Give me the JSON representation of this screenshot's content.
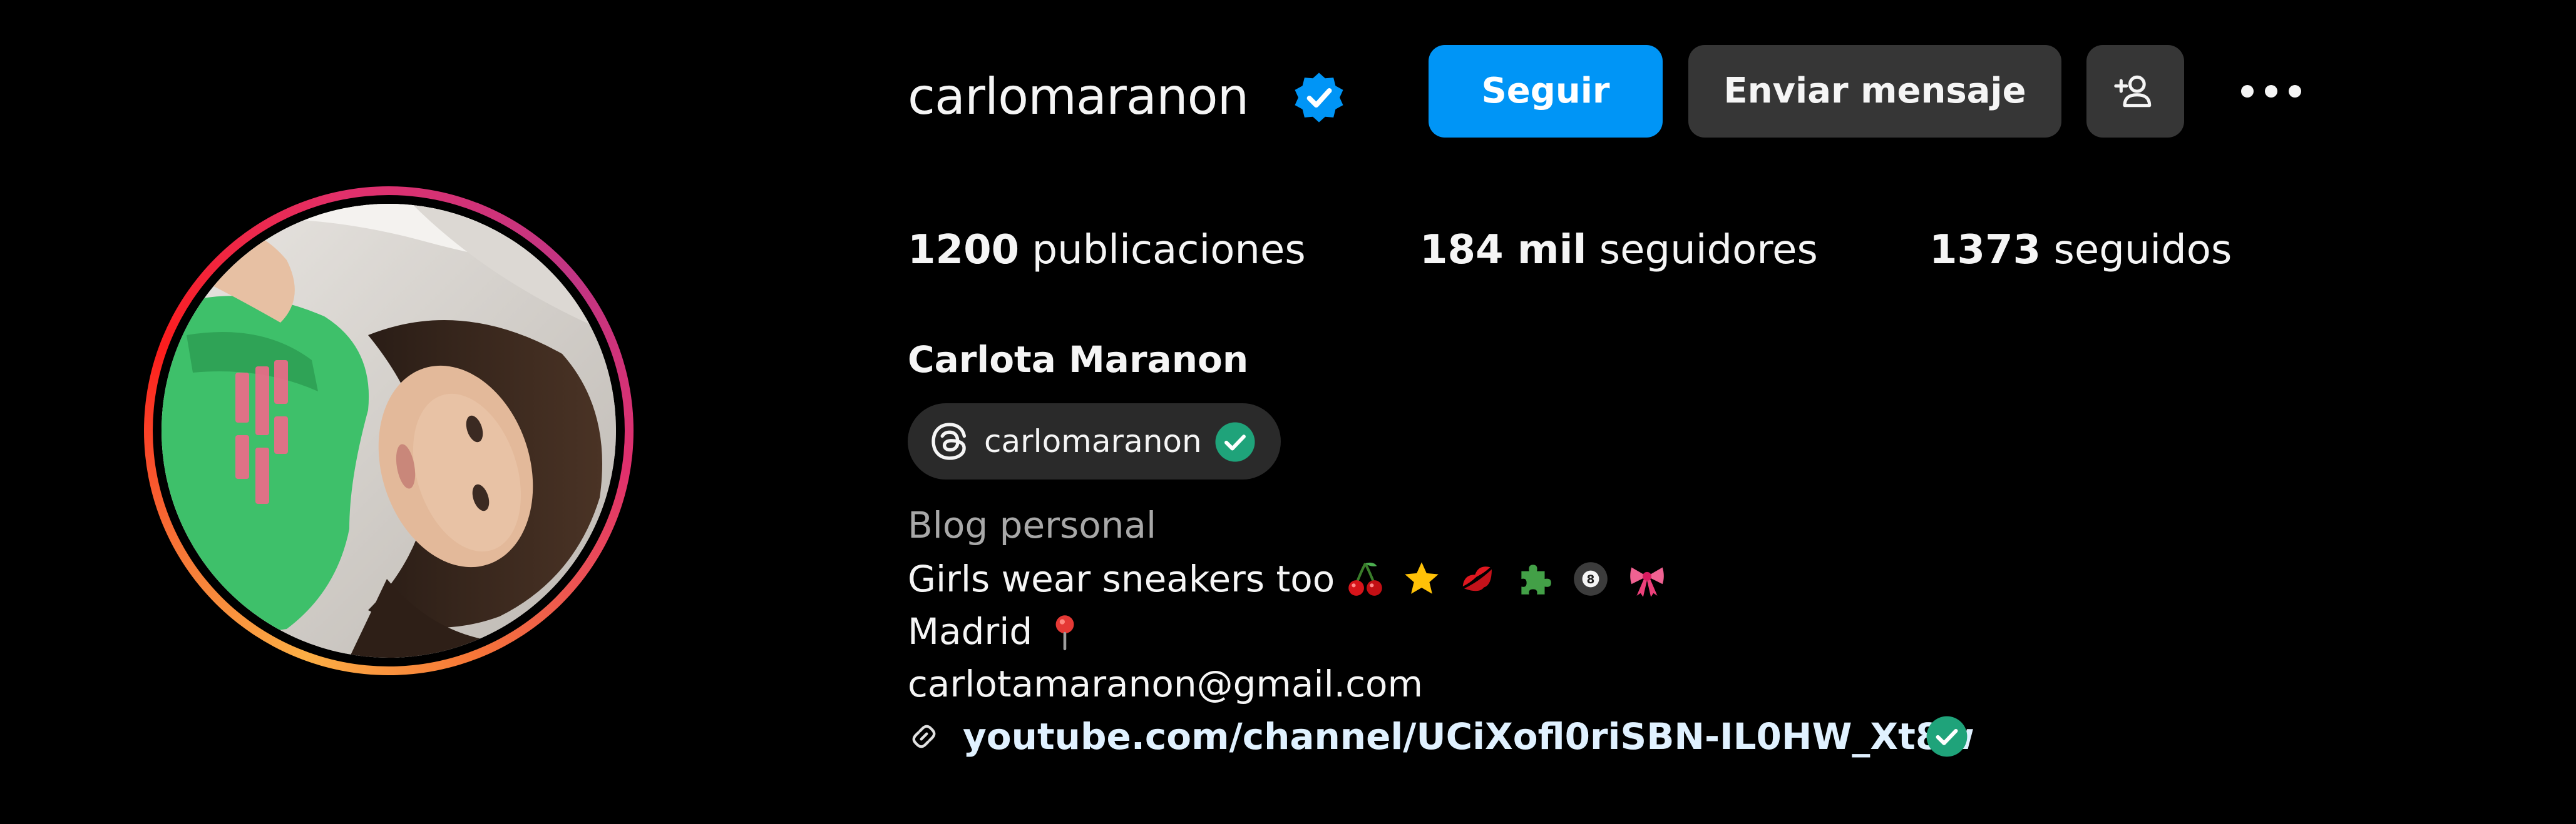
{
  "profile": {
    "username": "carlomaranon",
    "full_name": "Carlota Maranon",
    "verified": true,
    "avatar_description": "profile-photo"
  },
  "actions": {
    "follow_label": "Seguir",
    "message_label": "Enviar mensaje"
  },
  "stats": {
    "posts_count": "1200",
    "posts_label": "publicaciones",
    "followers_count": "184 mil",
    "followers_label": "seguidores",
    "following_count": "1373",
    "following_label": "seguidos"
  },
  "threads": {
    "handle": "carlomaranon",
    "icon": "threads-icon"
  },
  "bio": {
    "category": "Blog personal",
    "line1": "Girls wear sneakers too",
    "line1_emojis": [
      "cherries",
      "star",
      "kiss-mark",
      "puzzle-piece",
      "8-ball",
      "ribbon"
    ],
    "line2": "Madrid",
    "line2_emoji": "round-pushpin",
    "email": "carlotamaranon@gmail.com",
    "link": "youtube.com/channel/UCiXofl0riSBN-IL0HW_Xt8w"
  },
  "colors": {
    "background": "#000000",
    "follow_button": "#0095f6",
    "secondary_button": "#363636",
    "verified_blue": "#0095f6",
    "verified_green": "#1fa37a",
    "muted_text": "#a8a8a8"
  }
}
